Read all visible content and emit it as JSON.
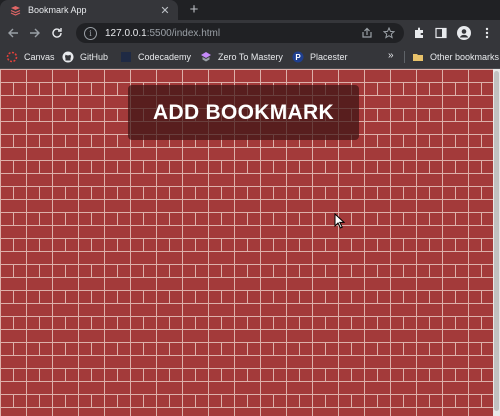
{
  "tab": {
    "title": "Bookmark App",
    "close_glyph": "✕",
    "new_tab_glyph": "+"
  },
  "toolbar": {
    "url_host": "127.0.0.1",
    "url_rest": ":5500/index.html",
    "icons": [
      "back-icon",
      "forward-icon",
      "reload-icon",
      "site-info-icon",
      "share-icon",
      "star-icon",
      "extensions-icon",
      "side-panel-icon",
      "profile-icon",
      "menu-icon"
    ]
  },
  "bookmarks": {
    "items": [
      {
        "label": "Canvas",
        "icon": "canvas-icon"
      },
      {
        "label": "GitHub",
        "icon": "github-icon"
      },
      {
        "label": "Codecademy",
        "icon": "codecademy-icon"
      },
      {
        "label": "Zero To Mastery",
        "icon": "ztm-icon"
      },
      {
        "label": "Placester",
        "icon": "placester-icon"
      }
    ],
    "more_glyph": "»",
    "other_label": "Other bookmarks"
  },
  "page": {
    "add_button_label": "ADD BOOKMARK",
    "colors": {
      "brick": "#a33a3a",
      "mortar": "#ddb0aa",
      "button_bg": "#3c1414"
    }
  }
}
